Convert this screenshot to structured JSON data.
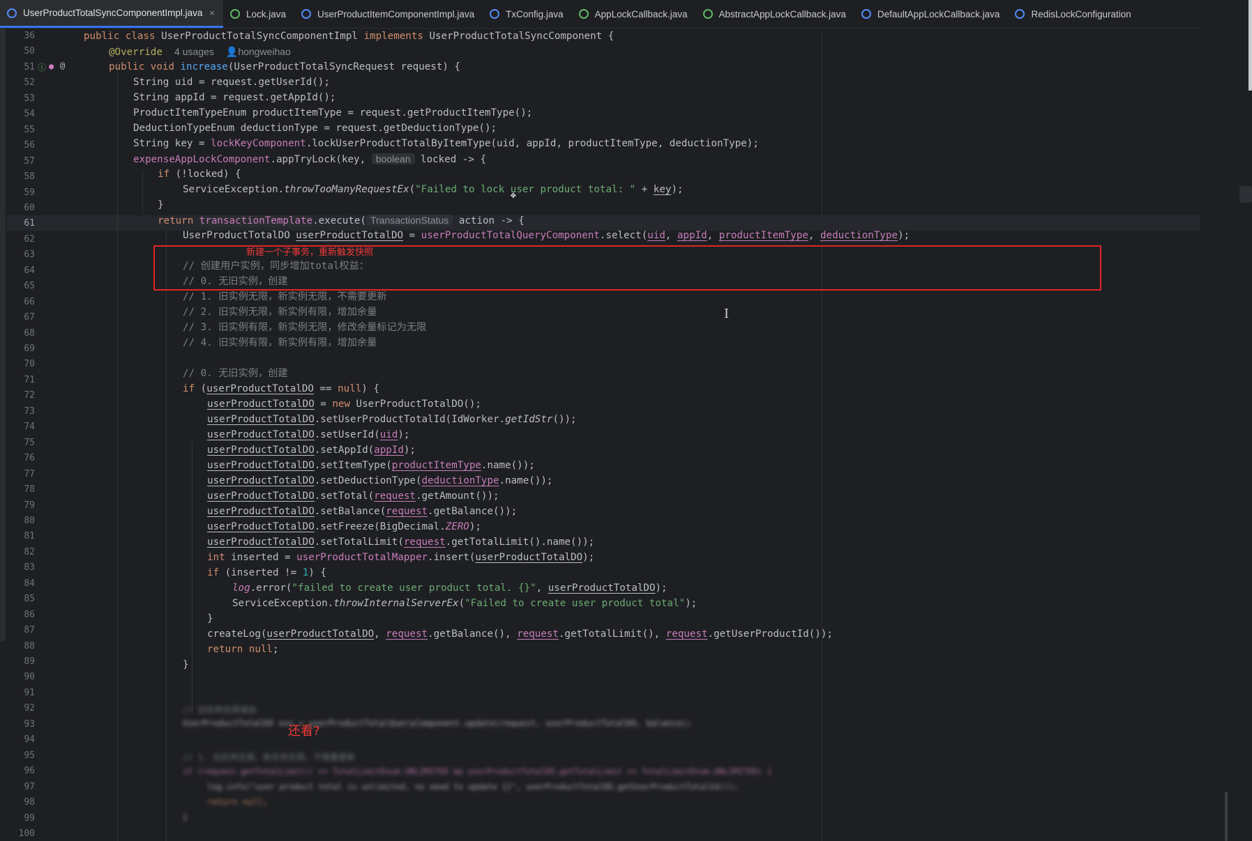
{
  "tabs": [
    {
      "label": "UserProductTotalSyncComponentImpl.java",
      "icon": "class-icon",
      "active": true,
      "close": "×"
    },
    {
      "label": "Lock.java",
      "icon": "interface-icon"
    },
    {
      "label": "UserProductItemComponentImpl.java",
      "icon": "class-icon"
    },
    {
      "label": "TxConfig.java",
      "icon": "class-icon"
    },
    {
      "label": "AppLockCallback.java",
      "icon": "interface-icon"
    },
    {
      "label": "AbstractAppLockCallback.java",
      "icon": "interface-icon"
    },
    {
      "label": "DefaultAppLockCallback.java",
      "icon": "class-icon"
    },
    {
      "label": "RedisLockConfiguration",
      "icon": "class-icon"
    }
  ],
  "gutter": {
    "line_numbers": [
      "36",
      "50",
      "51",
      "52",
      "53",
      "54",
      "55",
      "56",
      "57",
      "58",
      "59",
      "60",
      "61",
      "62",
      "63",
      "64",
      "65",
      "66",
      "67",
      "68",
      "69",
      "70",
      "71",
      "72",
      "73",
      "74",
      "75",
      "76",
      "77",
      "78",
      "79",
      "80",
      "81",
      "82",
      "83",
      "84",
      "85",
      "86",
      "87",
      "88",
      "89",
      "90",
      "91",
      "92",
      "93",
      "94",
      "95",
      "96",
      "97",
      "98",
      "99",
      "100"
    ],
    "current_line": "61"
  },
  "code": {
    "sticky_header": {
      "kw1": "public",
      "kw2": "class",
      "name": "UserProductTotalSyncComponentImpl",
      "kw3": "implements",
      "iface": "UserProductTotalSyncComponent",
      "brace": "{"
    },
    "l50": {
      "annotation": "@Override",
      "usages": "4 usages",
      "author": "hongweihao"
    },
    "l51": {
      "kw": "public void",
      "fn": "increase",
      "rest": "(UserProductTotalSyncRequest request) {"
    },
    "l52": "String uid = request.getUserId();",
    "l53": "String appId = request.getAppId();",
    "l54": "ProductItemTypeEnum productItemType = request.getProductItemType();",
    "l55": "DeductionTypeEnum deductionType = request.getDeductionType();",
    "l56": {
      "a": "String key = ",
      "fld": "lockKeyComponent",
      "b": ".lockUserProductTotalByItemType(uid, appId, productItemType, deductionType);"
    },
    "l57": {
      "fld": "expenseAppLockComponent",
      "a": ".appTryLock(key, ",
      "hint": "boolean",
      "b": " locked -> {"
    },
    "l58": {
      "kw": "if",
      "rest": " (!locked) {"
    },
    "l59": {
      "a": "ServiceException.",
      "it": "throwTooManyRequestEx",
      "b": "(",
      "str": "\"Failed to lock user product total: \"",
      "c": " + ",
      "ul": "key",
      "d": ");"
    },
    "l60": "}",
    "l61": {
      "kw": "return",
      "fld": "transactionTemplate",
      "a": ".execute(",
      "hint": "TransactionStatus",
      "b": " action -> {"
    },
    "l62": {
      "a": "UserProductTotalDO ",
      "ul": "userProductTotalDO",
      "b": " = ",
      "fld": "userProductTotalQueryComponent",
      "c": ".select(",
      "p1": "uid",
      "p2": "appId",
      "p3": "productItemType",
      "p4": "deductionType",
      "d": ");"
    },
    "l64": "// 创建用户实例，同步增加total权益：",
    "l65": "// 0. 无旧实例，创建",
    "l66": "// 1. 旧实例无限，新实例无限，不需要更新",
    "l67": "// 2. 旧实例无限，新实例有限，增加余量",
    "l68": "// 3. 旧实例有限，新实例无限，修改余量标记为无限",
    "l69": "// 4. 旧实例有限，新实例有限，增加余量",
    "l71": "// 0. 无旧实例，创建",
    "l72": {
      "kw": "if",
      "a": " (",
      "ul": "userProductTotalDO",
      "b": " == ",
      "kw2": "null",
      "c": ") {"
    },
    "l73": {
      "ul": "userProductTotalDO",
      "a": " = ",
      "kw": "new",
      "b": " UserProductTotalDO();"
    },
    "l74": {
      "ul": "userProductTotalDO",
      "a": ".setUserProductTotalId(IdWorker.",
      "it": "getIdStr",
      "b": "());"
    },
    "l75": {
      "ul": "userProductTotalDO",
      "a": ".setUserId(",
      "p": "uid",
      "b": ");"
    },
    "l76": {
      "ul": "userProductTotalDO",
      "a": ".setAppId(",
      "p": "appId",
      "b": ");"
    },
    "l77": {
      "ul": "userProductTotalDO",
      "a": ".setItemType(",
      "p": "productItemType",
      "b": ".name());"
    },
    "l78": {
      "ul": "userProductTotalDO",
      "a": ".setDeductionType(",
      "p": "deductionType",
      "b": ".name());"
    },
    "l79": {
      "ul": "userProductTotalDO",
      "a": ".setTotal(",
      "p": "request",
      "b": ".getAmount());"
    },
    "l80": {
      "ul": "userProductTotalDO",
      "a": ".setBalance(",
      "p": "request",
      "b": ".getBalance());"
    },
    "l81": {
      "ul": "userProductTotalDO",
      "a": ".setFreeze(BigDecimal.",
      "it": "ZERO",
      "b": ");"
    },
    "l82": {
      "ul": "userProductTotalDO",
      "a": ".setTotalLimit(",
      "p": "request",
      "b": ".getTotalLimit().name());"
    },
    "l83": {
      "kw": "int",
      "a": " inserted = ",
      "fld": "userProductTotalMapper",
      "b": ".insert(",
      "ul": "userProductTotalDO",
      "c": ");"
    },
    "l84": {
      "kw": "if",
      "a": " (inserted != ",
      "num": "1",
      "b": ") {"
    },
    "l85": {
      "it": "log",
      "a": ".error(",
      "str": "\"failed to create user product total. {}\"",
      "b": ", ",
      "ul": "userProductTotalDO",
      "c": ");"
    },
    "l86": {
      "a": "ServiceException.",
      "it": "throwInternalServerEx",
      "b": "(",
      "str": "\"Failed to create user product total\"",
      "c": ");"
    },
    "l87": "}",
    "l88": {
      "a": "createLog(",
      "ul": "userProductTotalDO",
      "b": ", ",
      "p1": "request",
      "c": ".getBalance(), ",
      "p2": "request",
      "d": ".getTotalLimit(), ",
      "p3": "request",
      "e": ".getUserProductId());"
    },
    "l89": {
      "kw": "return",
      "kw2": "null",
      "a": ";"
    },
    "l90": "}",
    "blur92": "// 旧实例无限增加",
    "blur93": "UserProductTotalDO xxx = userProductTotalQueryComponent.update(request, userProductTotalDO, balance);",
    "blur95": "// 1. 旧实例无限，新实例无限，不需要更新",
    "blur96": "if (request.getTotalLimit() == TotalLimitEnum.UNLIMITED && userProductTotalDO.getTotalLimit == TotalLimitEnum.UNLIMITED) {",
    "blur97": "log.info(\"user product total is unlimited, no need to update {}\", userProductTotalDO.getUserProductTotalId());",
    "blur98": "return null;",
    "blur99": "}"
  },
  "annotations": {
    "box_note": "新建一个子事务，重新触发快照",
    "bottom_note": "还看?"
  },
  "colors": {
    "background": "#1e1f22",
    "keyword": "#cf8e6d",
    "method": "#56a8f5",
    "field": "#c77dbb",
    "string": "#6aab73",
    "number": "#2aacb8",
    "annotation": "#b3ae60",
    "comment": "#7a7e85",
    "highlight_box": "#e02727",
    "active_tab_underline": "#3574f0"
  }
}
